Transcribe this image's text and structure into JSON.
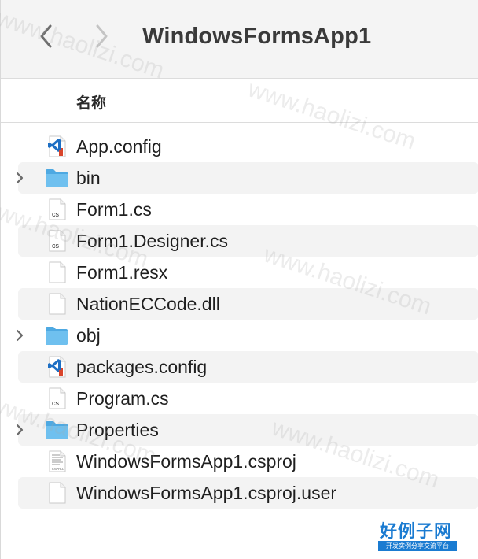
{
  "window": {
    "title": "WindowsFormsApp1"
  },
  "columns": {
    "name": "名称"
  },
  "files": [
    {
      "name": "App.config",
      "kind": "vscode-config",
      "expandable": false
    },
    {
      "name": "bin",
      "kind": "folder",
      "expandable": true
    },
    {
      "name": "Form1.cs",
      "kind": "cs",
      "expandable": false
    },
    {
      "name": "Form1.Designer.cs",
      "kind": "cs",
      "expandable": false
    },
    {
      "name": "Form1.resx",
      "kind": "blank",
      "expandable": false
    },
    {
      "name": "NationECCode.dll",
      "kind": "blank",
      "expandable": false
    },
    {
      "name": "obj",
      "kind": "folder",
      "expandable": true
    },
    {
      "name": "packages.config",
      "kind": "vscode-config",
      "expandable": false
    },
    {
      "name": "Program.cs",
      "kind": "cs",
      "expandable": false
    },
    {
      "name": "Properties",
      "kind": "folder",
      "expandable": true
    },
    {
      "name": "WindowsFormsApp1.csproj",
      "kind": "csproj",
      "expandable": false
    },
    {
      "name": "WindowsFormsApp1.csproj.user",
      "kind": "blank",
      "expandable": false
    }
  ],
  "icons": {
    "back": "chevron-left-icon",
    "forward": "chevron-right-icon",
    "disclosure": "chevron-right-icon"
  },
  "colors": {
    "folder": "#5bb4ea",
    "vscode": "#1e6fc4",
    "brand": "#1a7bd1"
  },
  "watermark": {
    "text": "www.haolizi.com",
    "logo_main": "好例子网",
    "logo_sub": "开发实例分享交流平台"
  }
}
